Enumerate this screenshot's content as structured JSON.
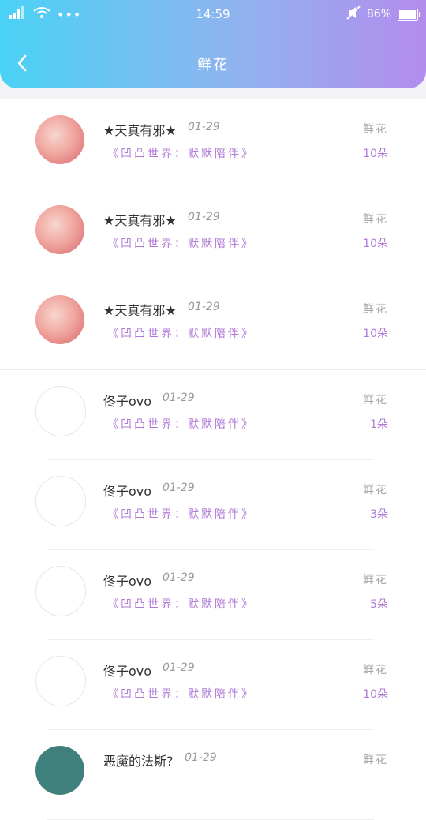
{
  "status": {
    "time": "14:59",
    "battery": "86%",
    "battery_level": 0.86
  },
  "header": {
    "title": "鲜花",
    "back_icon": "chevron-left-icon"
  },
  "colors": {
    "gradient_start": "#49d2f5",
    "gradient_end": "#b48cee",
    "accent": "#b079d6"
  },
  "rows": [
    {
      "name": "★天真有邪★",
      "date": "01-29",
      "sub": "《凹凸世界：默默陪伴》",
      "gift_label": "鲜花",
      "count": "10朵",
      "avatar": "colored"
    },
    {
      "name": "★天真有邪★",
      "date": "01-29",
      "sub": "《凹凸世界：默默陪伴》",
      "gift_label": "鲜花",
      "count": "10朵",
      "avatar": "colored"
    },
    {
      "name": "★天真有邪★",
      "date": "01-29",
      "sub": "《凹凸世界：默默陪伴》",
      "gift_label": "鲜花",
      "count": "10朵",
      "avatar": "colored"
    },
    {
      "name": "佟子ovo",
      "date": "01-29",
      "sub": "《凹凸世界：默默陪伴》",
      "gift_label": "鲜花",
      "count": "1朵",
      "avatar": "sketch"
    },
    {
      "name": "佟子ovo",
      "date": "01-29",
      "sub": "《凹凸世界：默默陪伴》",
      "gift_label": "鲜花",
      "count": "3朵",
      "avatar": "sketch"
    },
    {
      "name": "佟子ovo",
      "date": "01-29",
      "sub": "《凹凸世界：默默陪伴》",
      "gift_label": "鲜花",
      "count": "5朵",
      "avatar": "sketch"
    },
    {
      "name": "佟子ovo",
      "date": "01-29",
      "sub": "《凹凸世界：默默陪伴》",
      "gift_label": "鲜花",
      "count": "10朵",
      "avatar": "sketch"
    },
    {
      "name": "恶魔的法斯?",
      "date": "01-29",
      "sub": "",
      "gift_label": "鲜花",
      "count": "",
      "avatar": "teal"
    }
  ]
}
